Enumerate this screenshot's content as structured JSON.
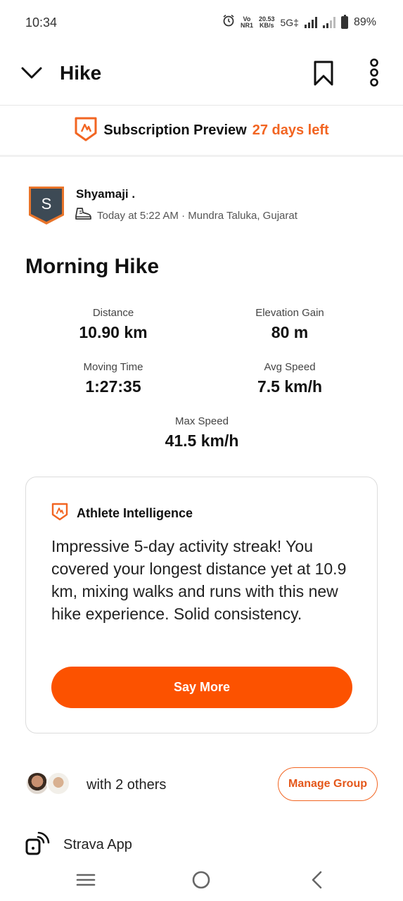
{
  "status_bar": {
    "time": "10:34",
    "volte_top": "Vo",
    "volte_bottom": "NR1",
    "speed_top": "20.53",
    "speed_bottom": "KB/s",
    "network": "5G‡",
    "battery": "89%"
  },
  "header": {
    "title": "Hike"
  },
  "subscription": {
    "label": "Subscription Preview",
    "days_left": "27 days left"
  },
  "athlete": {
    "avatar_letter": "S",
    "name": "Shyamaji .",
    "meta": "Today at 5:22 AM · Mundra Taluka, Gujarat"
  },
  "activity": {
    "title": "Morning Hike",
    "stats": [
      {
        "label": "Distance",
        "value": "10.90 km"
      },
      {
        "label": "Elevation Gain",
        "value": "80 m"
      },
      {
        "label": "Moving Time",
        "value": "1:27:35"
      },
      {
        "label": "Avg Speed",
        "value": "7.5 km/h"
      },
      {
        "label": "Max Speed",
        "value": "41.5 km/h"
      }
    ]
  },
  "athlete_intelligence": {
    "title": "Athlete Intelligence",
    "text": "Impressive 5-day activity streak! You covered your longest distance yet at 10.9 km, mixing walks and runs with this new hike experience. Solid consistency.",
    "button": "Say More"
  },
  "group": {
    "text": "with 2 others",
    "button": "Manage Group"
  },
  "device": {
    "text": "Strava App"
  },
  "colors": {
    "accent": "#fc5200",
    "accent_text": "#f26522"
  }
}
